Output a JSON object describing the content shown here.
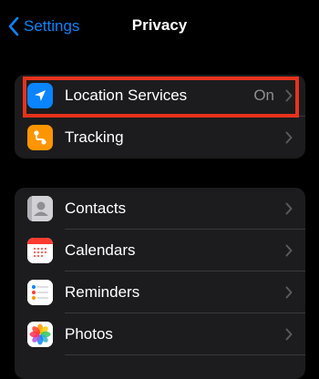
{
  "nav": {
    "back_label": "Settings",
    "title": "Privacy"
  },
  "group1": [
    {
      "label": "Location Services",
      "value": "On",
      "icon": "location-arrow-icon",
      "color": "#0a84ff"
    },
    {
      "label": "Tracking",
      "icon": "tracking-icon",
      "color": "#ff9500"
    }
  ],
  "group2": [
    {
      "label": "Contacts",
      "icon": "contacts-icon"
    },
    {
      "label": "Calendars",
      "icon": "calendar-icon"
    },
    {
      "label": "Reminders",
      "icon": "reminders-icon"
    },
    {
      "label": "Photos",
      "icon": "photos-icon"
    }
  ],
  "colors": {
    "accent": "#0a84ff",
    "highlight": "#e8321c",
    "cell": "#1c1c1e",
    "secondary_text": "#8e8e93"
  }
}
